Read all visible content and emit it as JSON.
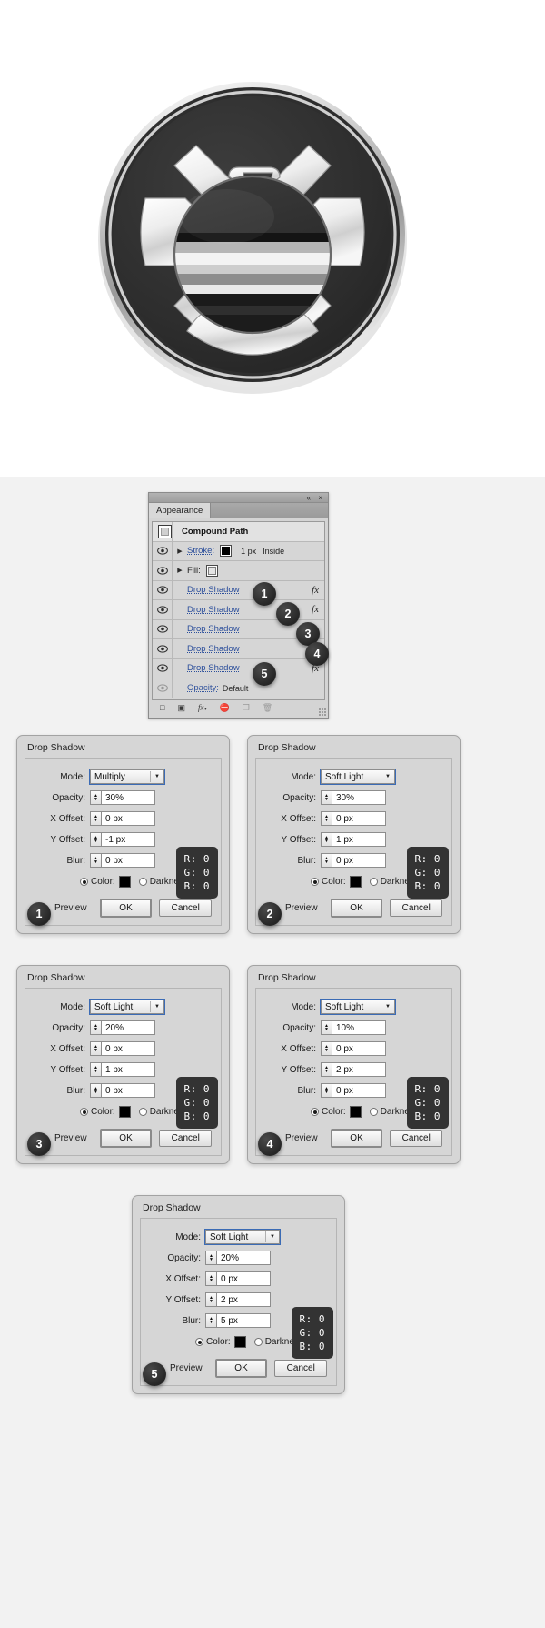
{
  "artwork": {
    "alt_name": "shield-eagle-emblem-illustration"
  },
  "appearance_panel": {
    "title_tab": "Appearance",
    "titlebar_icons": "«  ×",
    "target_label": "Compound Path",
    "rows": [
      {
        "label": "Stroke:",
        "link": true,
        "meta": "1 px",
        "meta2": "Inside",
        "fx": "",
        "eye": true,
        "arrow": true,
        "swatch": "black"
      },
      {
        "label": "Fill:",
        "link": false,
        "meta": "",
        "meta2": "",
        "fx": "",
        "eye": true,
        "arrow": true,
        "swatch": "white"
      },
      {
        "label": "Drop Shadow",
        "link": true,
        "meta": "",
        "meta2": "",
        "fx": "fx",
        "eye": true,
        "arrow": false,
        "swatch": ""
      },
      {
        "label": "Drop Shadow",
        "link": true,
        "meta": "",
        "meta2": "",
        "fx": "fx",
        "eye": true,
        "arrow": false,
        "swatch": ""
      },
      {
        "label": "Drop Shadow",
        "link": true,
        "meta": "",
        "meta2": "",
        "fx": "fx",
        "eye": true,
        "arrow": false,
        "swatch": ""
      },
      {
        "label": "Drop Shadow",
        "link": true,
        "meta": "",
        "meta2": "",
        "fx": "fx",
        "eye": true,
        "arrow": false,
        "swatch": ""
      },
      {
        "label": "Drop Shadow",
        "link": true,
        "meta": "",
        "meta2": "",
        "fx": "fx",
        "eye": true,
        "arrow": false,
        "swatch": ""
      },
      {
        "label": "Opacity:",
        "link": true,
        "meta": "Default",
        "meta2": "",
        "fx": "",
        "eye": false,
        "arrow": false,
        "swatch": ""
      }
    ],
    "footer_icons": [
      "new-art-has-basic-appearance-icon",
      "clear-appearance-icon",
      "fx-icon",
      "duplicate-item-icon",
      "delete-item-icon"
    ],
    "badges": [
      "1",
      "2",
      "3",
      "4",
      "5"
    ]
  },
  "dialogs": [
    {
      "badge": "1",
      "title": "Drop Shadow",
      "labels": {
        "mode": "Mode:",
        "opacity": "Opacity:",
        "x_offset": "X Offset:",
        "y_offset": "Y Offset:",
        "blur": "Blur:",
        "color": "Color:",
        "darkness": "Darkness:",
        "preview": "Preview"
      },
      "mode": "Multiply",
      "opacity": "30%",
      "x_offset": "0 px",
      "y_offset": "-1 px",
      "blur": "0 px",
      "color_selected": true,
      "ok": "OK",
      "cancel": "Cancel",
      "rgb": {
        "r": "R: 0",
        "g": "G: 0",
        "b": "B: 0"
      }
    },
    {
      "badge": "2",
      "title": "Drop Shadow",
      "labels": {
        "mode": "Mode:",
        "opacity": "Opacity:",
        "x_offset": "X Offset:",
        "y_offset": "Y Offset:",
        "blur": "Blur:",
        "color": "Color:",
        "darkness": "Darkness:",
        "preview": "Preview"
      },
      "mode": "Soft Light",
      "opacity": "30%",
      "x_offset": "0 px",
      "y_offset": "1 px",
      "blur": "0 px",
      "color_selected": true,
      "ok": "OK",
      "cancel": "Cancel",
      "rgb": {
        "r": "R: 0",
        "g": "G: 0",
        "b": "B: 0"
      }
    },
    {
      "badge": "3",
      "title": "Drop Shadow",
      "labels": {
        "mode": "Mode:",
        "opacity": "Opacity:",
        "x_offset": "X Offset:",
        "y_offset": "Y Offset:",
        "blur": "Blur:",
        "color": "Color:",
        "darkness": "Darkness:",
        "preview": "Preview"
      },
      "mode": "Soft Light",
      "opacity": "20%",
      "x_offset": "0 px",
      "y_offset": "1 px",
      "blur": "0 px",
      "color_selected": true,
      "ok": "OK",
      "cancel": "Cancel",
      "rgb": {
        "r": "R: 0",
        "g": "G: 0",
        "b": "B: 0"
      }
    },
    {
      "badge": "4",
      "title": "Drop Shadow",
      "labels": {
        "mode": "Mode:",
        "opacity": "Opacity:",
        "x_offset": "X Offset:",
        "y_offset": "Y Offset:",
        "blur": "Blur:",
        "color": "Color:",
        "darkness": "Darkness:",
        "preview": "Preview"
      },
      "mode": "Soft Light",
      "opacity": "10%",
      "x_offset": "0 px",
      "y_offset": "2 px",
      "blur": "0 px",
      "color_selected": true,
      "ok": "OK",
      "cancel": "Cancel",
      "rgb": {
        "r": "R: 0",
        "g": "G: 0",
        "b": "B: 0"
      }
    },
    {
      "badge": "5",
      "title": "Drop Shadow",
      "labels": {
        "mode": "Mode:",
        "opacity": "Opacity:",
        "x_offset": "X Offset:",
        "y_offset": "Y Offset:",
        "blur": "Blur:",
        "color": "Color:",
        "darkness": "Darkness:",
        "preview": "Preview"
      },
      "mode": "Soft Light",
      "opacity": "20%",
      "x_offset": "0 px",
      "y_offset": "2 px",
      "blur": "5 px",
      "color_selected": true,
      "ok": "OK",
      "cancel": "Cancel",
      "rgb": {
        "r": "R: 0",
        "g": "G: 0",
        "b": "B: 0"
      }
    }
  ],
  "colors": {
    "panel_bg": "#d6d6d6",
    "link_blue": "#2b4e9b",
    "badge_dark": "#262626",
    "tooltip_bg": "#333333",
    "emblem_dark": "#2b2b2b",
    "emblem_light": "#e8e8e8"
  }
}
